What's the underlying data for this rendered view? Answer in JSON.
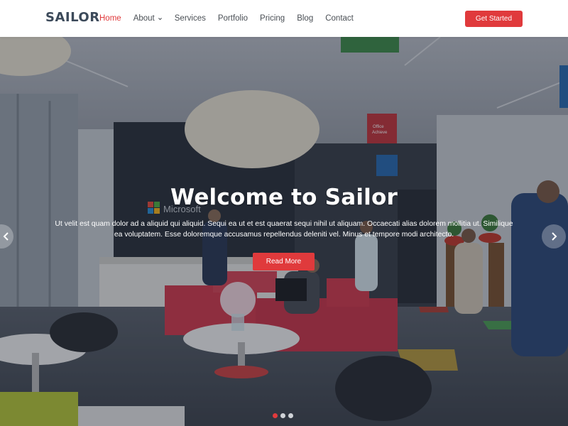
{
  "header": {
    "logo": "SAILOR",
    "nav": [
      {
        "label": "Home",
        "active": true
      },
      {
        "label": "About",
        "dropdown": true
      },
      {
        "label": "Services"
      },
      {
        "label": "Portfolio"
      },
      {
        "label": "Pricing"
      },
      {
        "label": "Blog"
      },
      {
        "label": "Contact"
      }
    ],
    "cta_label": "Get Started"
  },
  "hero": {
    "title": "Welcome to Sailor",
    "description": "Ut velit est quam dolor ad a aliquid qui aliquid. Sequi ea ut et est quaerat sequi nihil ut aliquam. Occaecati alias dolorem mollitia ut. Similique ea voluptatem. Esse doloremque accusamus repellendus deleniti vel. Minus et tempore modi architecto.",
    "button_label": "Read More",
    "slide_count": 3,
    "active_slide": 1,
    "background_text": {
      "microsoft_sign": "Microsoft",
      "office_banner": "Office",
      "achieve_banner": "Achieve"
    }
  },
  "colors": {
    "accent": "#e03a3c",
    "logo": "#3c4a5a",
    "nav_text": "#4a4f55"
  },
  "icons": {
    "dropdown": "chevron-down-icon",
    "prev": "chevron-left-icon",
    "next": "chevron-right-icon"
  }
}
